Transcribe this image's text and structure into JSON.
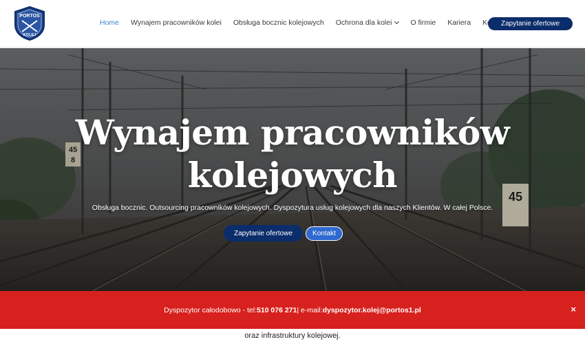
{
  "header": {
    "logo_alt": "PORTOS KOLEJ",
    "nav": [
      {
        "label": "Home",
        "active": true
      },
      {
        "label": "Wynajem pracowników kolei",
        "active": false
      },
      {
        "label": "Obsługa bocznic kolejowych",
        "active": false
      },
      {
        "label": "Ochrona dla kolei",
        "active": false,
        "dropdown": true
      },
      {
        "label": "O firmie",
        "active": false
      },
      {
        "label": "Kariera",
        "active": false
      },
      {
        "label": "Kontakt",
        "active": false
      }
    ],
    "cta_label": "Zapytanie ofertowe"
  },
  "hero": {
    "title_line1": "Wynajem pracowników",
    "title_line2": "kolejowych",
    "subtitle": "Obsługa bocznic. Outsourcing pracowników kolejowych. Dyspozytura usług kolejowych dla naszych Klientów. W całej Polsce.",
    "primary_button": "Zapytanie ofertowe",
    "secondary_button": "Kontakt",
    "sign_left": "45 8",
    "sign_right": "45"
  },
  "below": {
    "text": "oraz infrastruktury kolejowej."
  },
  "alert": {
    "prefix": "Dyspozytor całodobowo - tel: ",
    "phone": "510 076 271",
    "sep": " | e-mail: ",
    "email": "dyspozytor.kolej@portos1.pl",
    "close": "×"
  },
  "colors": {
    "brand_navy": "#0c2d6b",
    "link_active": "#3b82d6",
    "alert_red": "#d7211e",
    "secondary_button": "#2f69d1"
  }
}
